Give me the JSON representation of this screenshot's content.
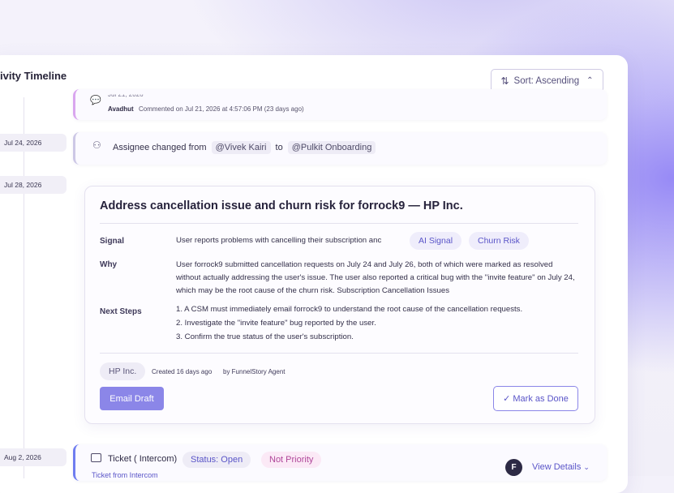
{
  "header": {
    "title": "ivity Timeline",
    "sort_label": "Sort: Ascending"
  },
  "timeline": {
    "dates": [
      "Jul 24, 2026",
      "Jul 28, 2026",
      "Aug 2, 2026"
    ]
  },
  "comment_event": {
    "date_partial": "Jul 21, 2026",
    "author": "Avadhut",
    "text": "Commented on Jul 21, 2026 at 4:57:06 PM (23 days ago)"
  },
  "assignee_event": {
    "prefix": "Assignee changed from",
    "from": "@Vivek Kairi",
    "connector": "to",
    "to": "@Pulkit Onboarding"
  },
  "task": {
    "title": "Address cancellation issue and churn risk for forrock9 — HP Inc.",
    "signal_label": "Signal",
    "signal_text": "User reports problems with cancelling their subscription anc",
    "tags": [
      "AI Signal",
      "Churn Risk"
    ],
    "why_label": "Why",
    "why_text": "User forrock9 submitted cancellation requests on July 24 and July 26, both of which were marked as resolved without actually addressing the user's issue. The user also reported a critical bug with the \"invite feature\" on July 24, which may be the root cause of the churn risk. Subscription Cancellation Issues",
    "next_label": "Next Steps",
    "next_steps": [
      "1. A CSM must immediately email forrock9 to understand the root cause of the cancellation requests.",
      "2. Investigate the \"invite feature\" bug reported by the user.",
      "3. Confirm the true status of the user's subscription."
    ],
    "company": "HP Inc.",
    "created": "Created 16 days ago",
    "by": "by FunnelStory Agent",
    "email_btn": "Email Draft",
    "done_btn": "✓ Mark as Done"
  },
  "ticket_event": {
    "label": "Ticket ( Intercom)",
    "status": "Status: Open",
    "priority": "Not Priority",
    "sub": "Ticket from Intercom",
    "avatar_letter": "F",
    "view_details": "View Details"
  },
  "colors": {
    "accent": "#8b86e8",
    "accent_text": "#5a55c8",
    "comment_border": "#d9a6ef",
    "ticket_border": "#6f7df0",
    "priority_bg": "#fbe9f6",
    "priority_text": "#b0479a"
  }
}
